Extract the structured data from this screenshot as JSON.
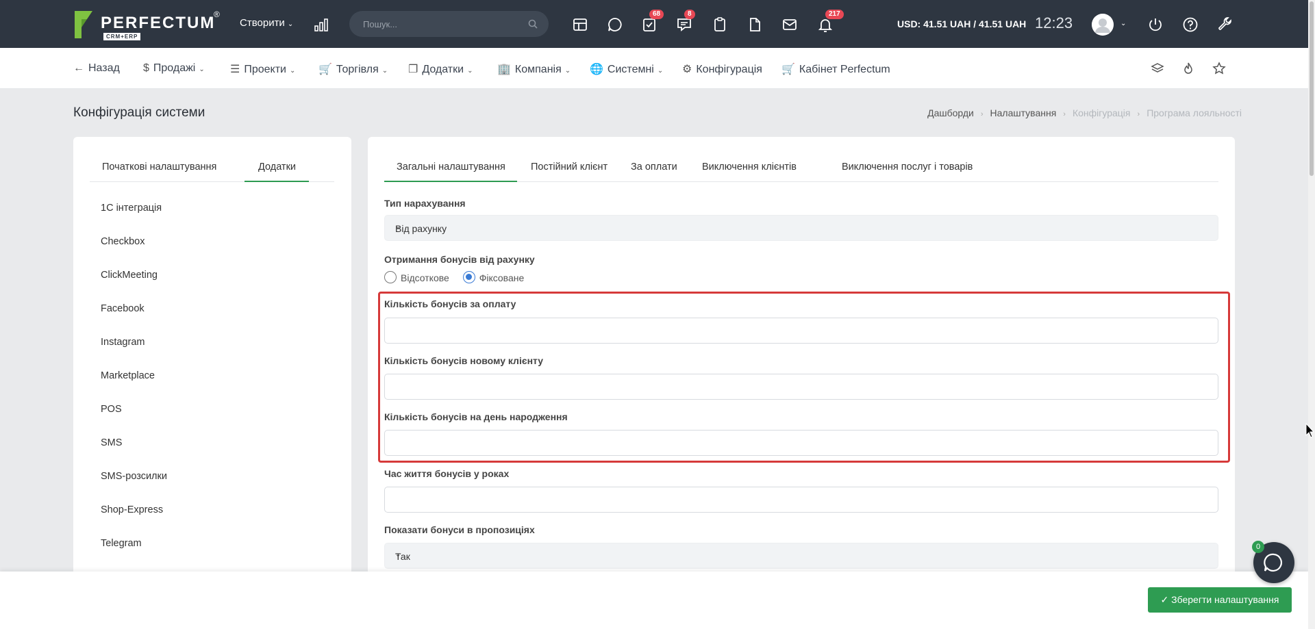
{
  "topbar": {
    "logo_text": "PERFECTUM",
    "logo_sub": "CRM+ERP",
    "logo_reg": "®",
    "create_label": "Створити",
    "search_placeholder": "Пошук...",
    "badges": {
      "tasks": "68",
      "messages": "8",
      "notifications": "217"
    },
    "currency": "USD: 41.51 UAH / 41.51 UAH",
    "time": "12:23",
    "colors": {
      "bg": "#2e3641",
      "badge": "#e84855"
    }
  },
  "nav2": {
    "back": "Назад",
    "sales": "Продажі",
    "projects": "Проекти",
    "trade": "Торгівля",
    "addons": "Додатки",
    "company": "Компанія",
    "system": "Системні",
    "config": "Конфігурація",
    "cabinet": "Кабінет Perfectum"
  },
  "page": {
    "title": "Конфігурація системи",
    "breadcrumb": [
      "Дашборди",
      "Налаштування",
      "Конфігурація",
      "Програма лояльності"
    ]
  },
  "left": {
    "tabs": [
      "Початкові налаштування",
      "Додатки"
    ],
    "items": [
      "1С інтеграція",
      "Checkbox",
      "ClickMeeting",
      "Facebook",
      "Instagram",
      "Marketplace",
      "POS",
      "SMS",
      "SMS-розсилки",
      "Shop-Express",
      "Telegram"
    ]
  },
  "right": {
    "tabs": [
      "Загальні налаштування",
      "Постійний клієнт",
      "За оплати",
      "Виключення клієнтів",
      "Виключення послуг і товарів"
    ],
    "accrual_type_label": "Тип нарахування",
    "accrual_type_value": "Від рахунку",
    "bonus_receive_label": "Отримання бонусів від рахунку",
    "radio_percent": "Відсоткове",
    "radio_fixed": "Фіксоване",
    "bonus_payment_label": "Кількість бонусів за оплату",
    "bonus_new_client_label": "Кількість бонусів новому клієнту",
    "bonus_birthday_label": "Кількість бонусів на день народження",
    "bonus_lifetime_label": "Час життя бонусів у роках",
    "show_bonus_label": "Показати бонуси в пропозиціях",
    "show_bonus_value": "Так"
  },
  "bottom": {
    "save_label": "Зберегти налаштування",
    "chat_badge": "0",
    "accent": "#2e9c52"
  }
}
